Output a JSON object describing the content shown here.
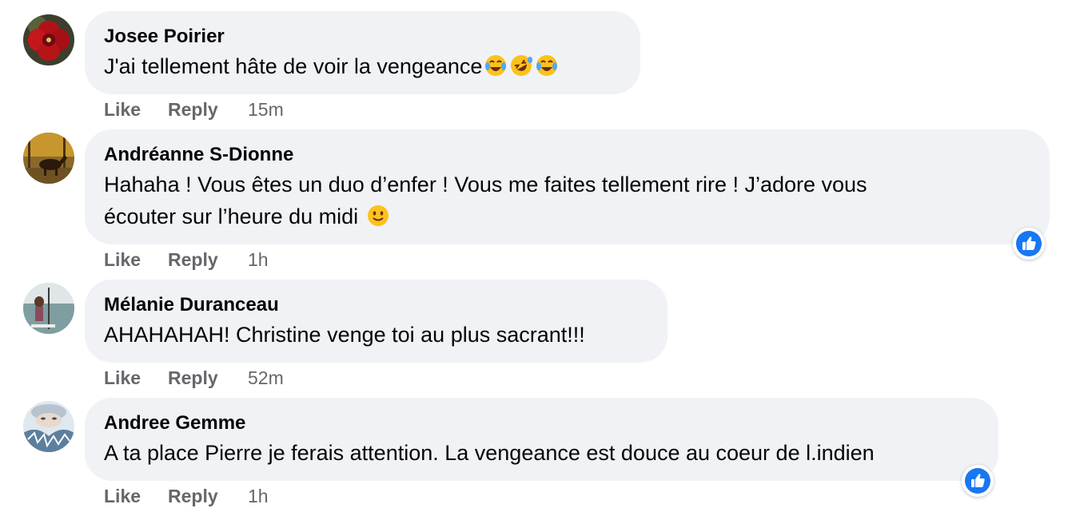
{
  "colors": {
    "bubble_bg": "#f0f2f5",
    "meta_text": "#65676b",
    "like_blue": "#1877f2"
  },
  "comments": [
    {
      "author": "Josee Poirier",
      "text": "J'ai tellement hâte de voir la vengeance",
      "emojis": [
        "tears-of-joy-emoji",
        "rolling-laughing-emoji",
        "tears-of-joy-emoji"
      ],
      "like_label": "Like",
      "reply_label": "Reply",
      "time": "15m",
      "avatar": "red-flower-avatar"
    },
    {
      "author": "Andréanne S-Dionne",
      "text_line1": "Hahaha ! Vous êtes un duo d’enfer ! Vous me faites tellement rire ! J’adore vous",
      "text_line2": "écouter sur l’heure du midi",
      "emojis": [
        "smiling-face-emoji"
      ],
      "like_label": "Like",
      "reply_label": "Reply",
      "time": "1h",
      "reaction": "like-reaction-icon",
      "avatar": "autumn-horse-avatar"
    },
    {
      "author": "Mélanie Duranceau",
      "text": "AHAHAHAH! Christine venge toi au plus sacrant!!!",
      "like_label": "Like",
      "reply_label": "Reply",
      "time": "52m",
      "avatar": "paddleboard-avatar"
    },
    {
      "author": "Andree Gemme",
      "text": "A ta place Pierre je ferais attention. La vengeance est douce au coeur de l.indien",
      "like_label": "Like",
      "reply_label": "Reply",
      "time": "1h",
      "reaction": "like-reaction-icon",
      "avatar": "winter-face-avatar"
    }
  ]
}
